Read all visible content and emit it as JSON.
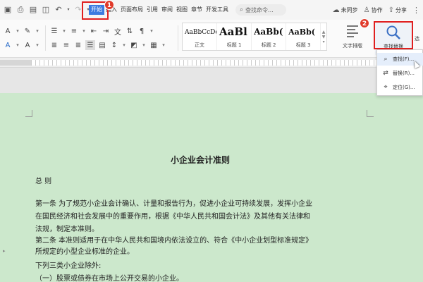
{
  "menu": {
    "tabs": [
      {
        "label": "开始",
        "active": true
      },
      {
        "label": "插入"
      },
      {
        "label": "页面布局"
      },
      {
        "label": "引用"
      },
      {
        "label": "审阅"
      },
      {
        "label": "视图"
      },
      {
        "label": "章节"
      },
      {
        "label": "开发工具"
      }
    ],
    "search_placeholder": "查找命令...",
    "actions": {
      "sync": "未同步",
      "collab": "协作",
      "share": "分享"
    }
  },
  "ribbon": {
    "styles": [
      {
        "sample": "AaBbCcDd",
        "caption": "正文"
      },
      {
        "sample": "AaBl",
        "caption": "标题 1"
      },
      {
        "sample": "AaBb(",
        "caption": "标题 2"
      },
      {
        "sample": "AaBb(",
        "caption": "标题 3"
      }
    ],
    "text_layout_label": "文字排版",
    "find_replace_label": "查找替换",
    "cutoff_label": "选"
  },
  "annotations": {
    "badge1": "1",
    "badge2": "2"
  },
  "dropdown": {
    "items": [
      {
        "label": "查找(F)...",
        "icon": "search-icon"
      },
      {
        "label": "替换(R)...",
        "icon": "replace-icon"
      },
      {
        "label": "定位(G)...",
        "icon": "locate-icon"
      }
    ]
  },
  "document": {
    "title": "小企业会计准则",
    "lines": [
      "总 则",
      "第一条 为了规范小企业会计确认、计量和报告行为，促进小企业可持续发展，发挥小企业",
      "在国民经济和社会发展中的重要作用，根据《中华人民共和国会计法》及其他有关法律和",
      "法规，制定本准则。",
      "第二条 本准则适用于在中华人民共和国境内依法设立的、符合《中小企业划型标准规定》",
      "所规定的小型企业标准的企业。",
      "下列三类小企业除外:",
      "（一）股票或债券在市场上公开交易的小企业。"
    ]
  },
  "colors": {
    "page_bg": "#cce8cc",
    "accent": "#3c7be0",
    "highlight": "#e02020"
  }
}
